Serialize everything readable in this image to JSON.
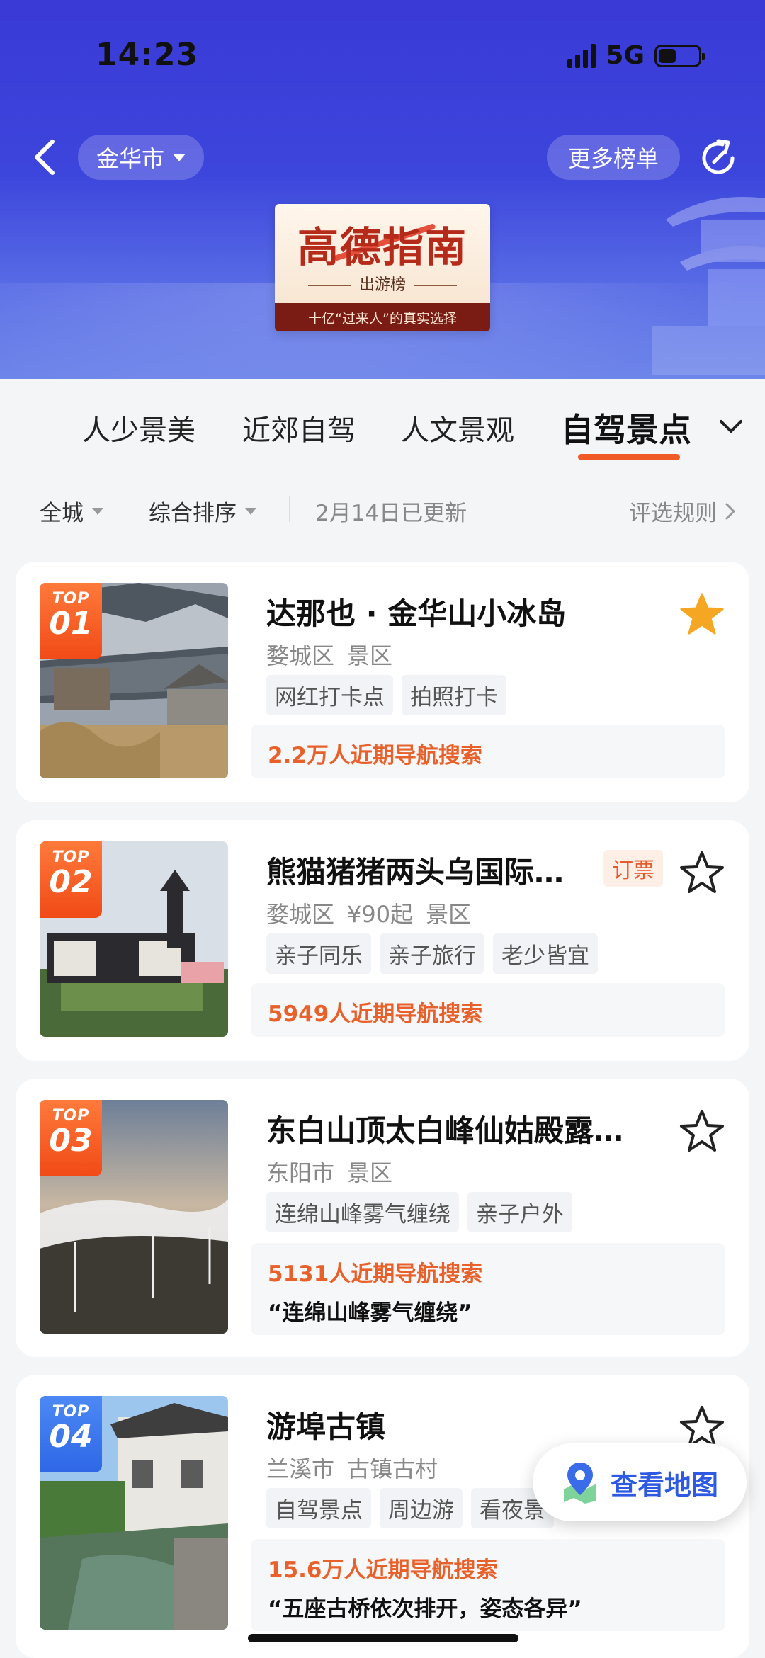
{
  "status_bar": {
    "time": "14:23",
    "network": "5G",
    "battery_level": 0.45
  },
  "header": {
    "city": "金华市",
    "more_label": "更多榜单",
    "logo": {
      "title": "高德指南",
      "subtitle": "出游榜",
      "footer": "十亿“过来人”的真实选择"
    },
    "icons": {
      "back": "back-arrow-icon",
      "share": "share-icon"
    },
    "colors": {
      "top": "#3a3ad6",
      "bottom": "#6f86ea"
    }
  },
  "tabs": {
    "items": [
      "人少景美",
      "近郊自驾",
      "人文景观",
      "自驾景点"
    ],
    "active_index": 3,
    "accent": "#f05a26"
  },
  "filters": {
    "scope": "全城",
    "sort": "综合排序",
    "updated": "2月14日已更新",
    "rules": "评选规则"
  },
  "list": [
    {
      "rank_top": "TOP",
      "rank": "01",
      "name": "达那也 · 金华山小冰岛",
      "meta": [
        "婺城区",
        "景区"
      ],
      "tags": [
        "网红打卡点",
        "拍照打卡"
      ],
      "stat": "2.2万人近期导航搜索",
      "favorited": true
    },
    {
      "rank_top": "TOP",
      "rank": "02",
      "name": "熊猫猪猪两头乌国际…",
      "book_tag": "订票",
      "meta": [
        "婺城区",
        "¥90起",
        "景区"
      ],
      "tags": [
        "亲子同乐",
        "亲子旅行",
        "老少皆宜"
      ],
      "stat": "5949人近期导航搜索",
      "favorited": false
    },
    {
      "rank_top": "TOP",
      "rank": "03",
      "name": "东白山顶太白峰仙姑殿露…",
      "meta": [
        "东阳市",
        "景区"
      ],
      "tags": [
        "连绵山峰雾气缠绕",
        "亲子户外"
      ],
      "stat": "5131人近期导航搜索",
      "quote": "“连绵山峰雾气缠绕”",
      "favorited": false
    },
    {
      "rank_top": "TOP",
      "rank": "04",
      "name": "游埠古镇",
      "meta": [
        "兰溪市",
        "古镇古村"
      ],
      "tags": [
        "自驾景点",
        "周边游",
        "看夜景"
      ],
      "stat": "15.6万人近期导航搜索",
      "quote": "“五座古桥依次排开，姿态各异”",
      "favorited": false
    }
  ],
  "map_button": {
    "label": "查看地图",
    "icon": "map-pin-icon"
  }
}
